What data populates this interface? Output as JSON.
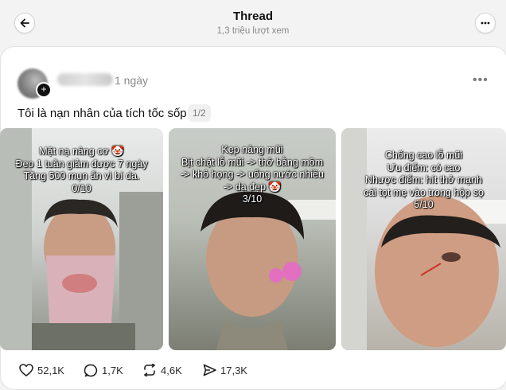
{
  "header": {
    "title": "Thread",
    "views": "1,3 triệu lượt xem"
  },
  "post": {
    "time": "1 ngày",
    "text": "Tôi là nạn nhân của tích tốc sốp",
    "page_indicator": "1/2",
    "media": [
      {
        "lines": [
          "Mặt nạ nâng cơ 🤡",
          "Đeo 1 tuần giảm được 7 ngày",
          "Tăng 500 mụn ẩn vì bí da.",
          "0/10"
        ]
      },
      {
        "lines": [
          "Kẹp nâng mũi",
          "Bịt chặt lỗ mũi -> thở bằng mồm",
          "-> khô họng -> uống nước nhiều",
          "-> da đẹp 🤡",
          "3/10"
        ]
      },
      {
        "lines": [
          "Chống cao lỗ mũi",
          "Ưu điểm: có cao",
          "Nhược điểm: hít thở mạnh",
          "cái tọt mẹ vào trong hộp sọ",
          "5/10"
        ]
      }
    ],
    "actions": {
      "likes": "52,1K",
      "replies": "1,7K",
      "reposts": "4,6K",
      "shares": "17,3K"
    }
  }
}
